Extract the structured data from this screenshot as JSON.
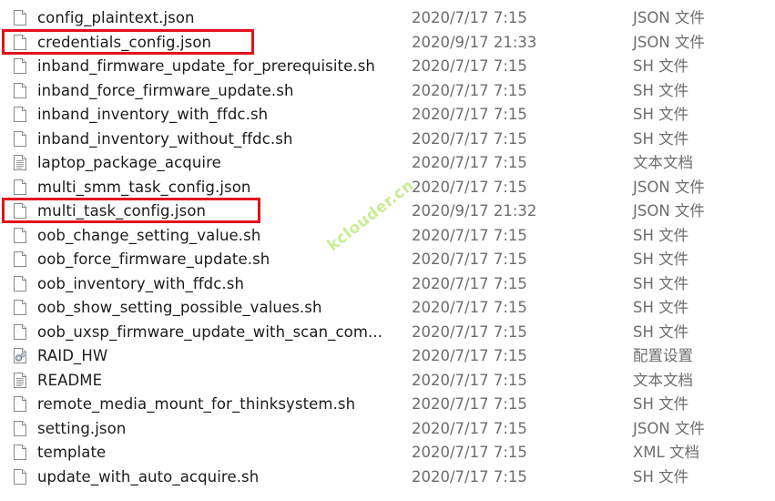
{
  "colors": {
    "highlight_border": "#e1121c",
    "watermark": "#9adf3f",
    "meta_text": "#6d6d6d"
  },
  "watermark": "kclouder.cn",
  "files": [
    {
      "name": "config_plaintext.json",
      "date": "2020/7/17 7:15",
      "type": "JSON 文件",
      "icon": "blank-file-icon",
      "highlighted": false
    },
    {
      "name": "credentials_config.json",
      "date": "2020/9/17 21:33",
      "type": "JSON 文件",
      "icon": "blank-file-icon",
      "highlighted": true
    },
    {
      "name": "inband_firmware_update_for_prerequisite.sh",
      "date": "2020/7/17 7:15",
      "type": "SH 文件",
      "icon": "blank-file-icon",
      "highlighted": false
    },
    {
      "name": "inband_force_firmware_update.sh",
      "date": "2020/7/17 7:15",
      "type": "SH 文件",
      "icon": "blank-file-icon",
      "highlighted": false
    },
    {
      "name": "inband_inventory_with_ffdc.sh",
      "date": "2020/7/17 7:15",
      "type": "SH 文件",
      "icon": "blank-file-icon",
      "highlighted": false
    },
    {
      "name": "inband_inventory_without_ffdc.sh",
      "date": "2020/7/17 7:15",
      "type": "SH 文件",
      "icon": "blank-file-icon",
      "highlighted": false
    },
    {
      "name": "laptop_package_acquire",
      "date": "2020/7/17 7:15",
      "type": "文本文档",
      "icon": "text-document-icon",
      "highlighted": false
    },
    {
      "name": "multi_smm_task_config.json",
      "date": "2020/7/17 7:15",
      "type": "JSON 文件",
      "icon": "blank-file-icon",
      "highlighted": false
    },
    {
      "name": "multi_task_config.json",
      "date": "2020/9/17 21:32",
      "type": "JSON 文件",
      "icon": "blank-file-icon",
      "highlighted": true
    },
    {
      "name": "oob_change_setting_value.sh",
      "date": "2020/7/17 7:15",
      "type": "SH 文件",
      "icon": "blank-file-icon",
      "highlighted": false
    },
    {
      "name": "oob_force_firmware_update.sh",
      "date": "2020/7/17 7:15",
      "type": "SH 文件",
      "icon": "blank-file-icon",
      "highlighted": false
    },
    {
      "name": "oob_inventory_with_ffdc.sh",
      "date": "2020/7/17 7:15",
      "type": "SH 文件",
      "icon": "blank-file-icon",
      "highlighted": false
    },
    {
      "name": "oob_show_setting_possible_values.sh",
      "date": "2020/7/17 7:15",
      "type": "SH 文件",
      "icon": "blank-file-icon",
      "highlighted": false
    },
    {
      "name": "oob_uxsp_firmware_update_with_scan_com...",
      "date": "2020/7/17 7:15",
      "type": "SH 文件",
      "icon": "blank-file-icon",
      "highlighted": false
    },
    {
      "name": "RAID_HW",
      "date": "2020/7/17 7:15",
      "type": "配置设置",
      "icon": "settings-file-icon",
      "highlighted": false
    },
    {
      "name": "README",
      "date": "2020/7/17 7:15",
      "type": "文本文档",
      "icon": "text-document-icon",
      "highlighted": false
    },
    {
      "name": "remote_media_mount_for_thinksystem.sh",
      "date": "2020/7/17 7:15",
      "type": "SH 文件",
      "icon": "blank-file-icon",
      "highlighted": false
    },
    {
      "name": "setting.json",
      "date": "2020/7/17 7:15",
      "type": "JSON 文件",
      "icon": "blank-file-icon",
      "highlighted": false
    },
    {
      "name": "template",
      "date": "2020/7/17 7:15",
      "type": "XML 文档",
      "icon": "blank-file-icon",
      "highlighted": false
    },
    {
      "name": "update_with_auto_acquire.sh",
      "date": "2020/7/17 7:15",
      "type": "SH 文件",
      "icon": "blank-file-icon",
      "highlighted": false
    }
  ]
}
